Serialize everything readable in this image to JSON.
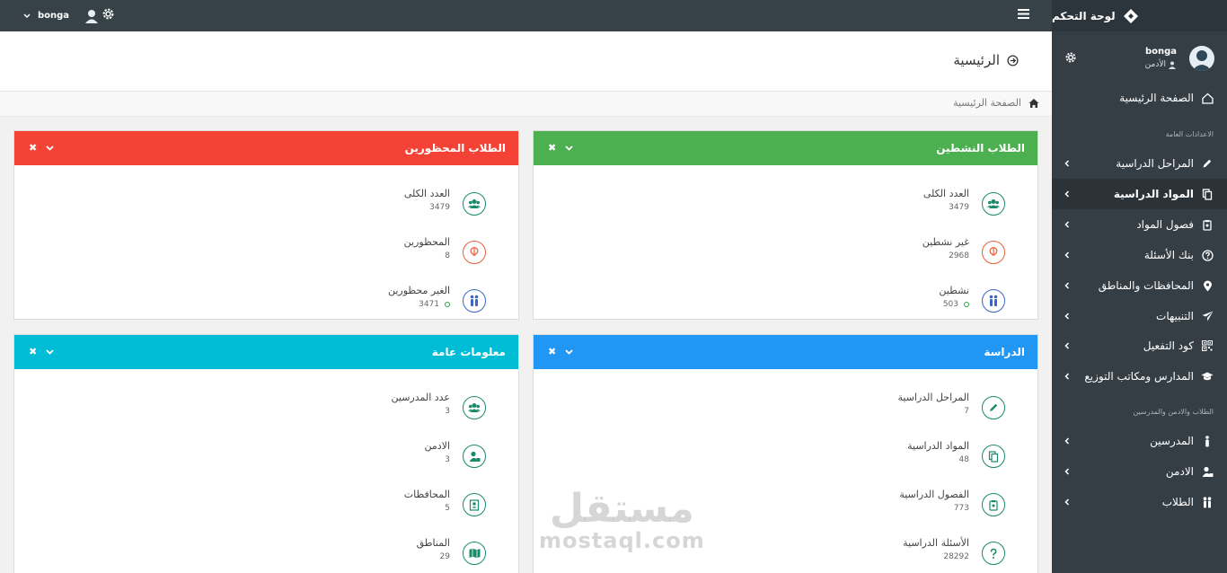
{
  "topbar": {
    "brand": "لوحة التحكم",
    "username": "bonga"
  },
  "sidebar": {
    "profile": {
      "name": "bonga",
      "role": "الأدمن"
    },
    "home": "الصفحة الرئيسية",
    "section_general": "الاعدادات العامة",
    "items_general": [
      {
        "label": "المراحل الدراسية",
        "icon": "pencil-icon"
      },
      {
        "label": "المواد الدراسية",
        "icon": "copy-icon"
      },
      {
        "label": "فصول المواد",
        "icon": "clipboard-icon"
      },
      {
        "label": "بنك الأسئلة",
        "icon": "question-icon"
      },
      {
        "label": "المحافظات والمناطق",
        "icon": "map-marker-icon"
      },
      {
        "label": "التنبيهات",
        "icon": "paper-plane-icon"
      },
      {
        "label": "كود التفعيل",
        "icon": "qrcode-icon"
      },
      {
        "label": "المدارس ومكاتب التوزيع",
        "icon": "graduation-cap-icon"
      }
    ],
    "section_people": "الطلاب والادمن والمدرسين",
    "items_people": [
      {
        "label": "المدرسين",
        "icon": "person-icon"
      },
      {
        "label": "الادمن",
        "icon": "user-admin-icon"
      },
      {
        "label": "الطلاب",
        "icon": "users-icon"
      }
    ]
  },
  "page": {
    "title": "الرئيسية",
    "breadcrumb": "الصفحة الرئيسية"
  },
  "panels": {
    "active": {
      "title": "الطلاب النشطين",
      "color": "#4caf50",
      "stats": [
        {
          "label": "العدد الكلى",
          "value": "3479"
        },
        {
          "label": "غير نشطين",
          "value": "2968"
        },
        {
          "label": "نشطين",
          "value": "503"
        }
      ]
    },
    "banned": {
      "title": "الطلاب المحظورين",
      "color": "#f44336",
      "stats": [
        {
          "label": "العدد الكلى",
          "value": "3479"
        },
        {
          "label": "المحظورين",
          "value": "8"
        },
        {
          "label": "الغير محظورين",
          "value": "3471"
        }
      ]
    },
    "study": {
      "title": "الدراسة",
      "color": "#2196f3",
      "stats": [
        {
          "label": "المراحل الدراسية",
          "value": "7"
        },
        {
          "label": "المواد الدراسية",
          "value": "48"
        },
        {
          "label": "الفصول الدراسية",
          "value": "773"
        },
        {
          "label": "الأسئلة الدراسية",
          "value": "28292"
        }
      ]
    },
    "general": {
      "title": "معلومات عامة",
      "color": "#00bcd4",
      "stats": [
        {
          "label": "عدد المدرسين",
          "value": "3"
        },
        {
          "label": "الادمن",
          "value": "3"
        },
        {
          "label": "المحافظات",
          "value": "5"
        },
        {
          "label": "المناطق",
          "value": "29"
        }
      ]
    }
  },
  "watermark": {
    "arabic": "مستقل",
    "latin": "mostaql.com"
  }
}
